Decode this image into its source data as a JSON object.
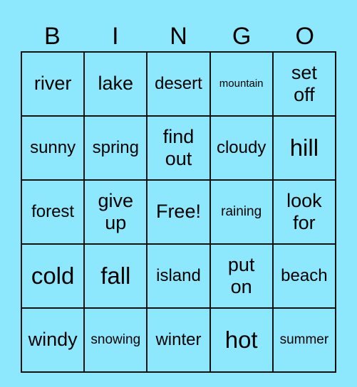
{
  "header": [
    "B",
    "I",
    "N",
    "G",
    "O"
  ],
  "card": {
    "background_color": "#8ee8fd",
    "rows": [
      [
        "river",
        "lake",
        "desert",
        "mountain",
        "set off"
      ],
      [
        "sunny",
        "spring",
        "find out",
        "cloudy",
        "hill"
      ],
      [
        "forest",
        "give up",
        "Free!",
        "raining",
        "look for"
      ],
      [
        "cold",
        "fall",
        "island",
        "put on",
        "beach"
      ],
      [
        "windy",
        "snowing",
        "winter",
        "hot",
        "summer"
      ]
    ]
  }
}
